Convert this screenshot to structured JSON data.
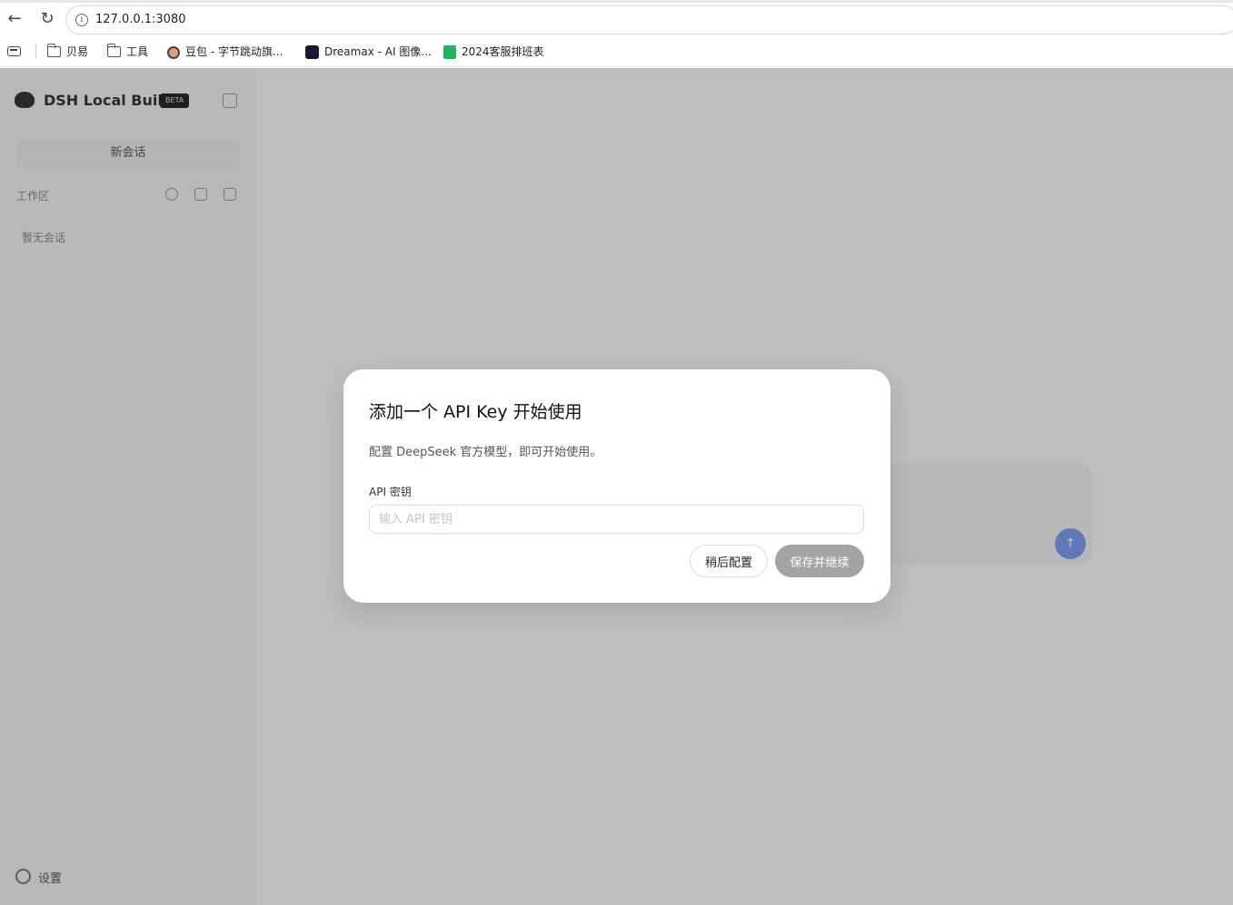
{
  "browser": {
    "url": "127.0.0.1:3080",
    "back_icon": "arrow-left-icon",
    "reload_icon": "reload-icon",
    "info_icon": "info-icon",
    "bookmarks": [
      {
        "label": "贝易",
        "icon": "folder-icon"
      },
      {
        "label": "工具",
        "icon": "folder-icon"
      },
      {
        "label": "豆包 - 字节跳动旗...",
        "icon": "doubao-favicon"
      },
      {
        "label": "Dreamax - AI 图像...",
        "icon": "dreamax-favicon"
      },
      {
        "label": "2024客服排班表",
        "icon": "sheet-favicon"
      }
    ]
  },
  "sidebar": {
    "brand": "DSH Local Build",
    "badge": "BETA",
    "new_chat": "新会话",
    "workspace_label": "工作区",
    "empty_text": "暂无会话",
    "settings_label": "设置"
  },
  "modal": {
    "title": "添加一个 API Key 开始使用",
    "description": "配置 DeepSeek 官方模型，即可开始使用。",
    "field_label": "API 密钥",
    "input_placeholder": "输入 API 密钥",
    "input_value": "",
    "later_button": "稍后配置",
    "save_button": "保存并继续"
  },
  "colors": {
    "overlay": "#000000",
    "save_button_disabled": "#a4a4a4",
    "send_button": "#7a9cf2"
  }
}
